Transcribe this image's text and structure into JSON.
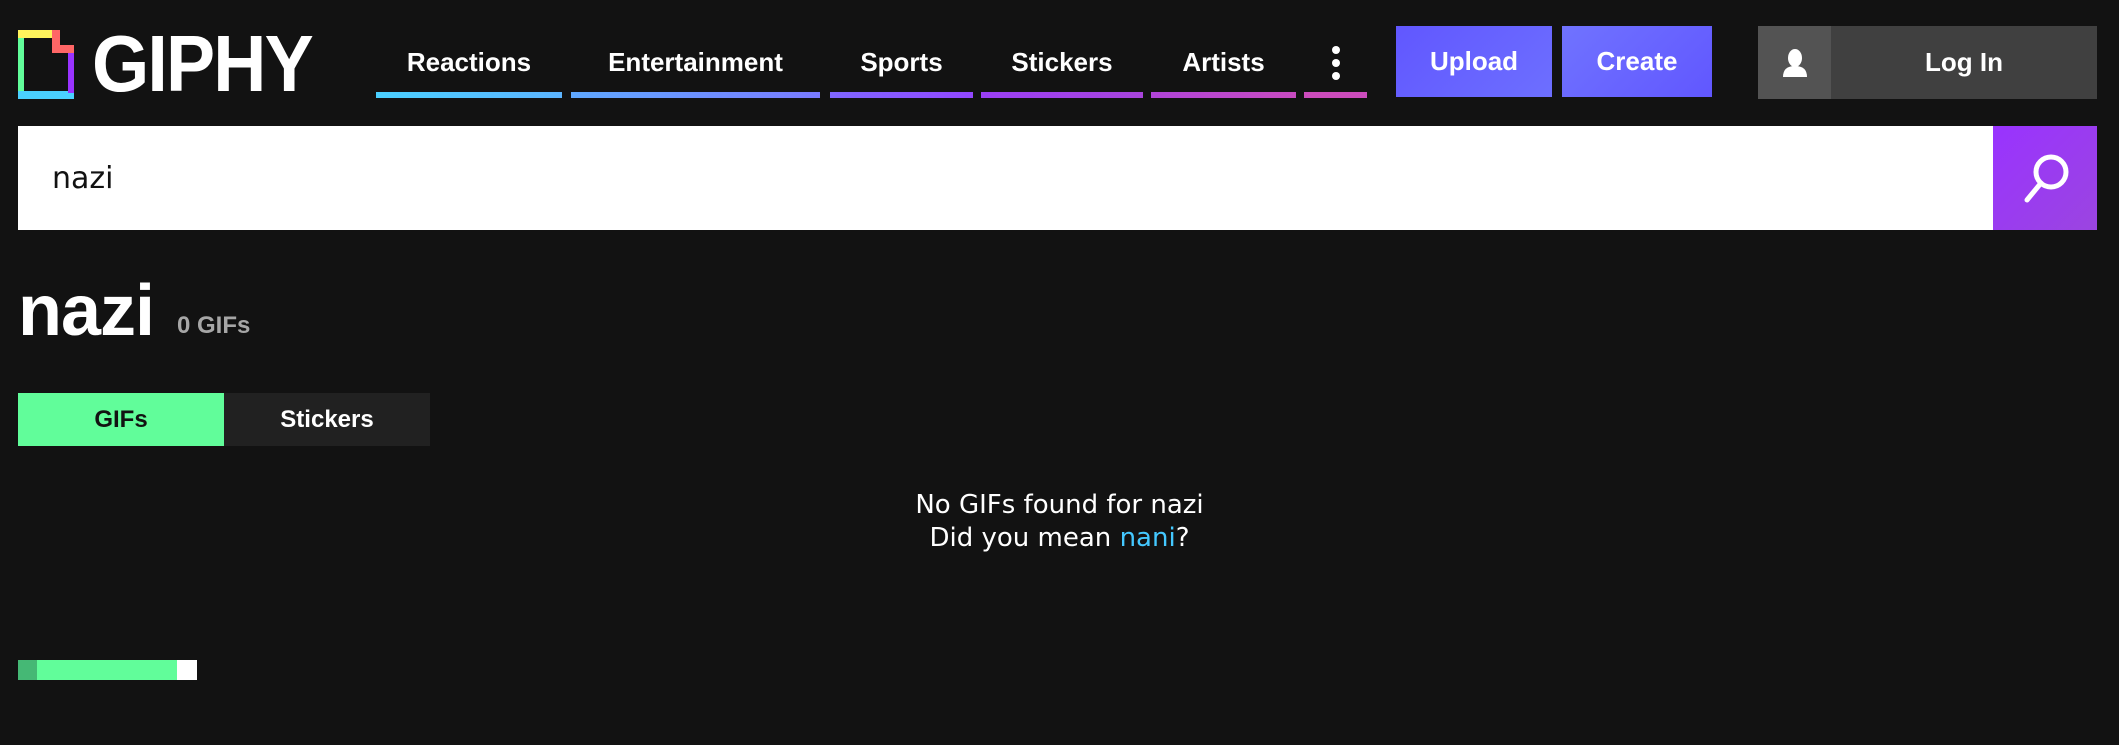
{
  "header": {
    "logo_text": "GIPHY",
    "nav": [
      {
        "label": "Reactions",
        "color": "#4ad0ff"
      },
      {
        "label": "Entertainment",
        "color": "#6a8dff"
      },
      {
        "label": "Sports",
        "color": "#8b5cff"
      },
      {
        "label": "Stickers",
        "color": "#9a3ff0"
      },
      {
        "label": "Artists",
        "color": "#b83fd0"
      }
    ],
    "more_icon": "vertical-ellipsis-icon",
    "upload_label": "Upload",
    "create_label": "Create",
    "login_label": "Log In",
    "user_icon": "user-icon"
  },
  "search": {
    "value": "nazi",
    "icon": "search-icon"
  },
  "results": {
    "title": "nazi",
    "count": "0 GIFs"
  },
  "tabs": [
    {
      "label": "GIFs",
      "active": true
    },
    {
      "label": "Stickers",
      "active": false
    }
  ],
  "message": {
    "line1": "No GIFs found for nazi",
    "line2_prefix": "Did you mean ",
    "suggestion": "nani",
    "line2_suffix": "?"
  },
  "colors": {
    "background": "#121212",
    "accent_green": "#61fd9a",
    "button_purple": "#6157ff",
    "search_purple": "#9933ff",
    "link": "#44c8ff"
  }
}
